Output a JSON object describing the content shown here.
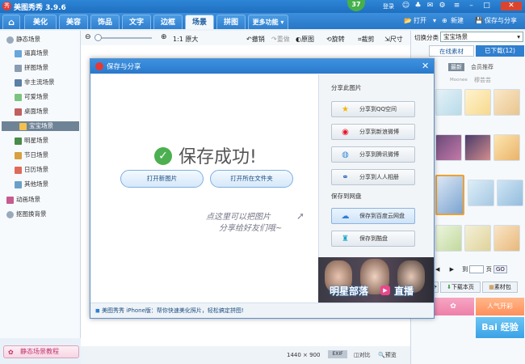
{
  "app": {
    "title": "美图秀秀 3.9.6",
    "level": "37",
    "login": "登录"
  },
  "menu": {
    "tabs": [
      "美化",
      "美容",
      "饰品",
      "文字",
      "边框",
      "场景",
      "拼图",
      "更多功能 ▾"
    ],
    "open_label": "打开",
    "new_label": "新建",
    "save_share_label": "保存与分享"
  },
  "toolbar": {
    "zoom_label": "1:1 原大",
    "undo": "撤销",
    "redo": "重做",
    "original": "原图",
    "rotate": "旋转",
    "crop": "裁剪",
    "size": "尺寸"
  },
  "sidebar": {
    "root": "静态场景",
    "items": [
      "逼真场景",
      "拼图场景",
      "非主流场景",
      "可爱场景",
      "桌面场景",
      "宝宝场景",
      "明星场景",
      "节日场景",
      "日历场景",
      "其他场景"
    ],
    "animated": "动画场景",
    "cutout": "抠图换背景",
    "tutorial": "静态场景教程"
  },
  "status": {
    "resolution": "1440 × 900",
    "compare": "对比",
    "preview": "预览"
  },
  "rightpanel": {
    "category_label": "切换分类",
    "category_value": "宝宝场景",
    "tab_online": "在线素材",
    "tab_downloaded": "已下载(12)",
    "sub_tabs": [
      "最新",
      "会员推荐"
    ],
    "sub_tab_labels2": [
      "Moonee",
      "穆芸芸"
    ],
    "pager_to": "到",
    "pager_page": "页",
    "pager_go": "GO",
    "download_page": "下载本页",
    "material_pack": "素材包",
    "ad1": "人气开彩",
    "ad_watermark": "Bai 经验"
  },
  "dialog": {
    "title": "保存与分享",
    "success": "保存成功!",
    "open_new": "打开新图片",
    "open_folder": "打开所在文件夹",
    "handwrite_line1": "点这里可以把图片",
    "handwrite_line2": "分享给好友们哦~",
    "share_section": "分享此图片",
    "share_buttons": [
      "分享到QQ空间",
      "分享到新浪微博",
      "分享到腾讯微博",
      "分享到人人相册"
    ],
    "cloud_section": "保存到网盘",
    "cloud_buttons": [
      "保存到百度云网盘",
      "保存到酷盘"
    ],
    "banner_left": "明星部落",
    "banner_right": "直播",
    "footer": "美图秀秀 iPhone版：帮你快速美化照片，轻松搞定拼图!"
  }
}
